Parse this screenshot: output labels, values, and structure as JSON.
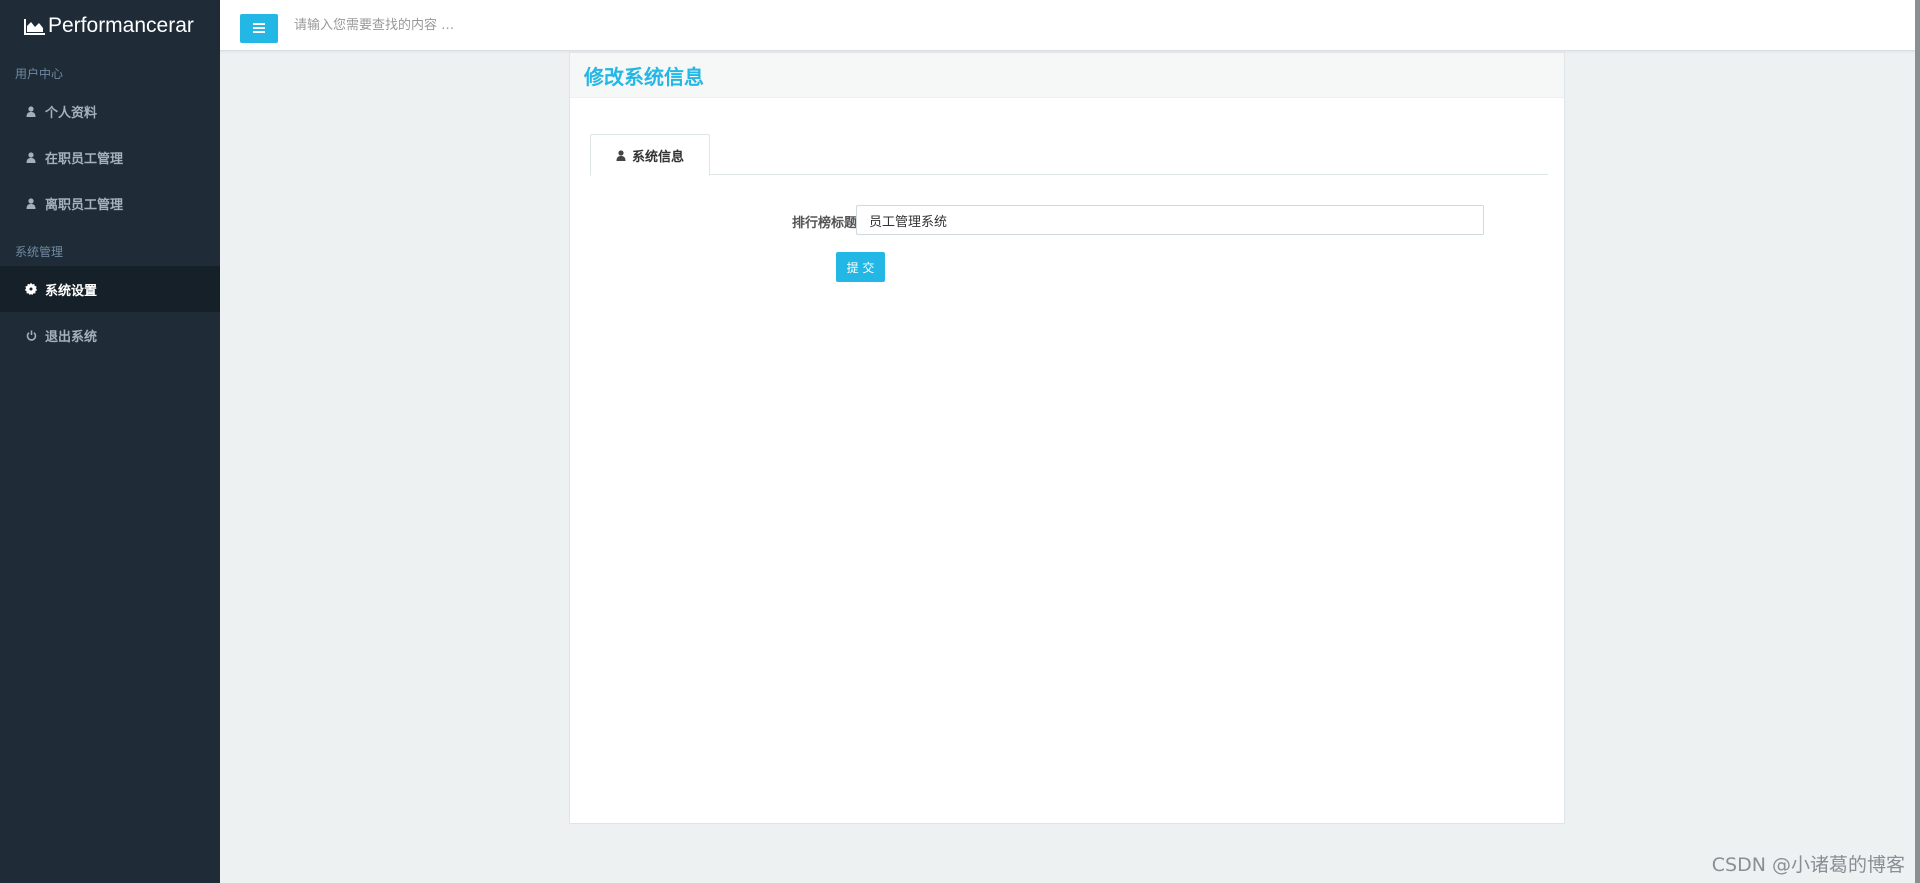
{
  "sidebar": {
    "brand": "Performancerar",
    "sections": [
      {
        "header": "用户中心",
        "items": [
          {
            "label": "个人资料",
            "icon": "user-icon"
          },
          {
            "label": "在职员工管理",
            "icon": "user-icon"
          },
          {
            "label": "离职员工管理",
            "icon": "user-icon"
          }
        ]
      },
      {
        "header": "系统管理",
        "items": [
          {
            "label": "系统设置",
            "icon": "gear-icon",
            "active": true
          },
          {
            "label": "退出系统",
            "icon": "power-icon"
          }
        ]
      }
    ]
  },
  "header": {
    "search_placeholder": "请输入您需要查找的内容 …"
  },
  "panel": {
    "title": "修改系统信息",
    "tab_label": "系统信息",
    "form": {
      "label": "排行榜标题：",
      "value": "员工管理系统",
      "submit_label": "提 交"
    }
  },
  "watermark": "CSDN @小诸葛的博客",
  "colors": {
    "accent": "#23b7e5",
    "sidebar_bg": "#1f2b37",
    "sidebar_active": "#162029",
    "page_bg": "#edf1f2"
  }
}
